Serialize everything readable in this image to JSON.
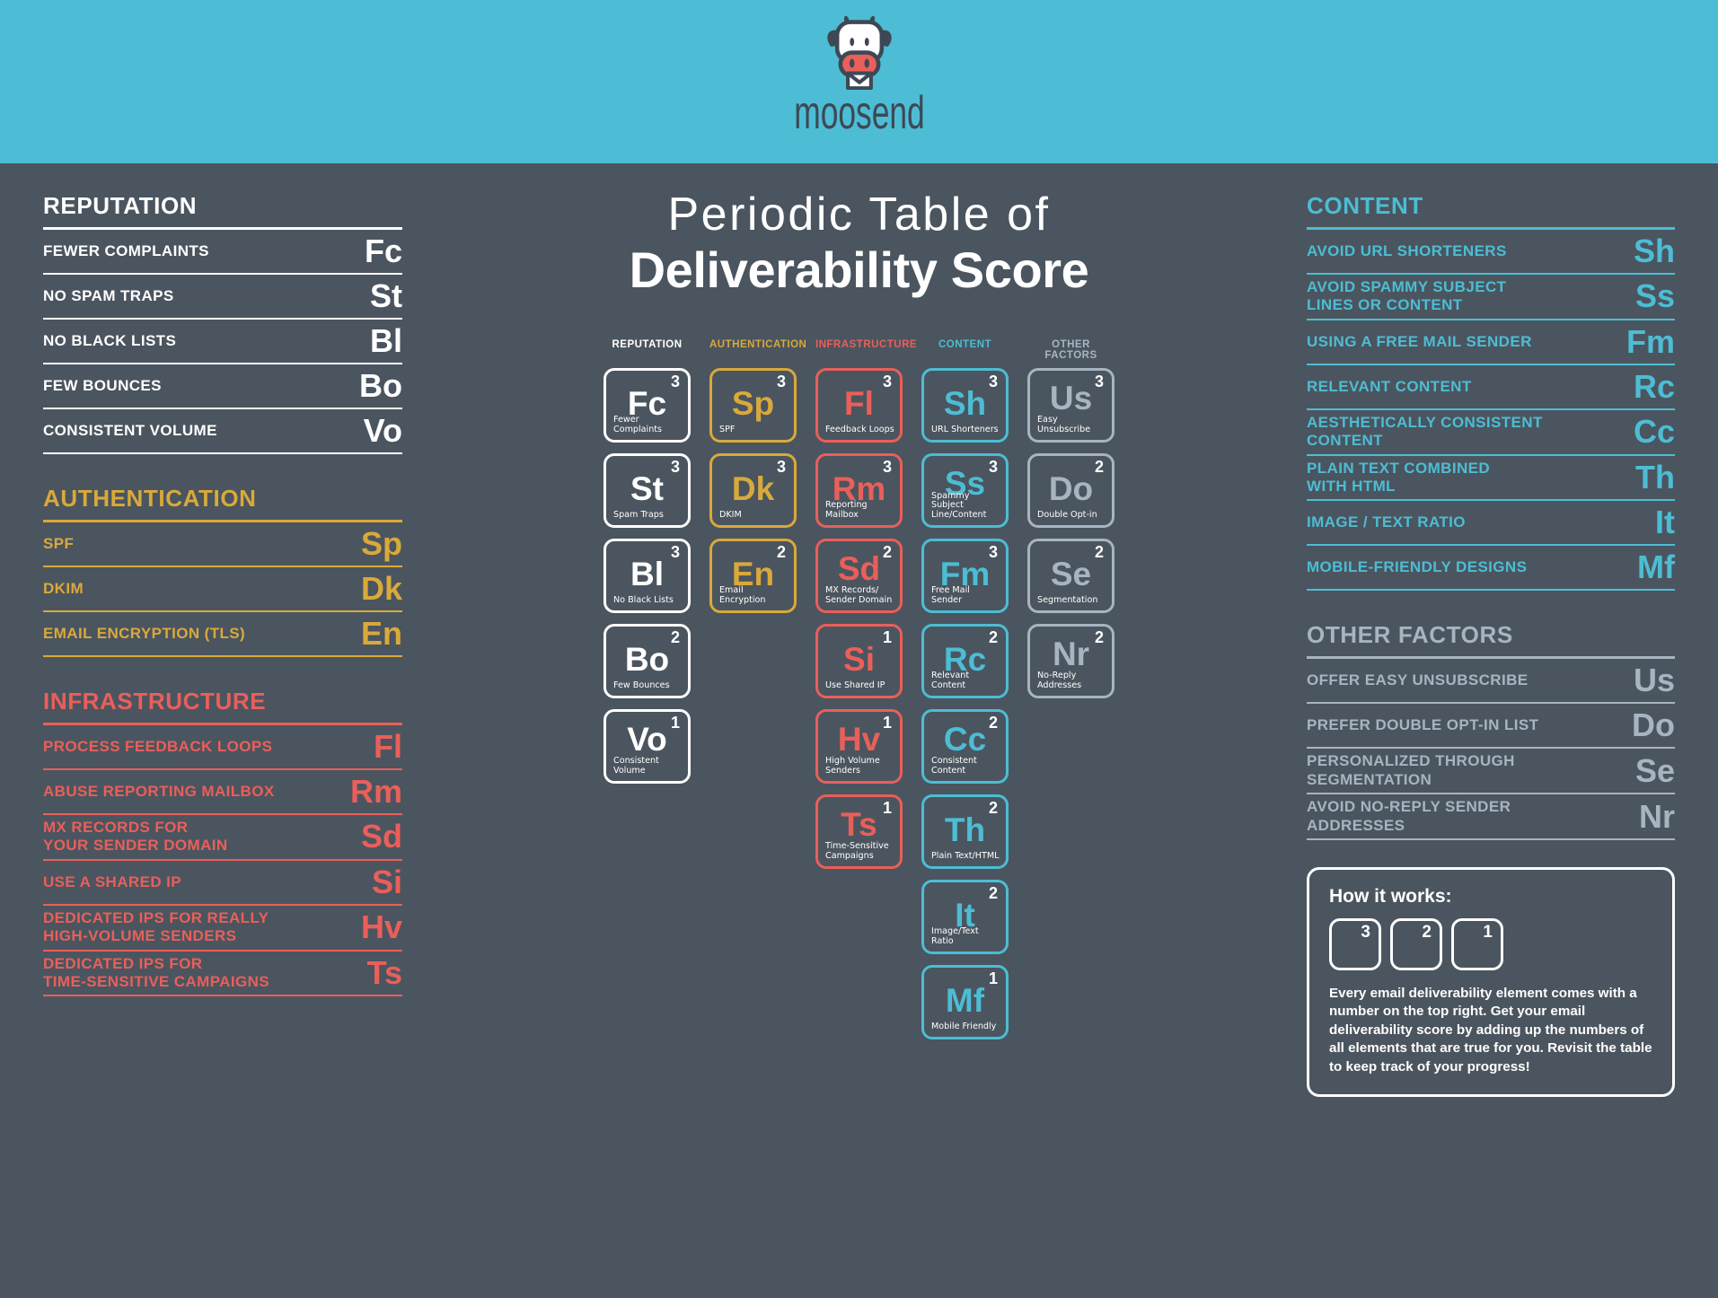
{
  "brand": {
    "name": "moosend",
    "logo_icon": "cow-envelope-logo",
    "header_bg": "#4cbdd4",
    "page_bg": "#4b555f"
  },
  "title": {
    "line1": "Periodic Table of",
    "line2": "Deliverability Score"
  },
  "colors": {
    "reputation": "#ffffff",
    "authentication": "#d9a93b",
    "infrastructure": "#ea5f5a",
    "content": "#4cbdd4",
    "other_factors": "#a7b4c2"
  },
  "left_sections": [
    {
      "title": "REPUTATION",
      "theme": "t-reputation",
      "rows": [
        {
          "label": "FEWER COMPLAINTS",
          "symbol": "Fc"
        },
        {
          "label": "NO SPAM TRAPS",
          "symbol": "St"
        },
        {
          "label": "NO BLACK LISTS",
          "symbol": "Bl"
        },
        {
          "label": "FEW BOUNCES",
          "symbol": "Bo"
        },
        {
          "label": "CONSISTENT VOLUME",
          "symbol": "Vo"
        }
      ]
    },
    {
      "title": "AUTHENTICATION",
      "theme": "t-auth",
      "rows": [
        {
          "label": "SPF",
          "symbol": "Sp"
        },
        {
          "label": "DKIM",
          "symbol": "Dk"
        },
        {
          "label": "EMAIL ENCRYPTION (TLS)",
          "symbol": "En"
        }
      ]
    },
    {
      "title": "INFRASTRUCTURE",
      "theme": "t-infra",
      "rows": [
        {
          "label": "PROCESS FEEDBACK LOOPS",
          "symbol": "Fl"
        },
        {
          "label": "ABUSE REPORTING MAILBOX",
          "symbol": "Rm"
        },
        {
          "label": "MX RECORDS FOR\nYOUR SENDER DOMAIN",
          "symbol": "Sd"
        },
        {
          "label": "USE A SHARED IP",
          "symbol": "Si"
        },
        {
          "label": "DEDICATED IPS FOR REALLY\nHIGH-VOLUME SENDERS",
          "symbol": "Hv"
        },
        {
          "label": "DEDICATED IPS FOR\nTIME-SENSITIVE CAMPAIGNS",
          "symbol": "Ts"
        }
      ]
    }
  ],
  "right_sections": [
    {
      "title": "CONTENT",
      "theme": "t-content",
      "rows": [
        {
          "label": "AVOID URL SHORTENERS",
          "symbol": "Sh"
        },
        {
          "label": "AVOID SPAMMY SUBJECT\nLINES OR CONTENT",
          "symbol": "Ss"
        },
        {
          "label": "USING A FREE MAIL SENDER",
          "symbol": "Fm"
        },
        {
          "label": "RELEVANT CONTENT",
          "symbol": "Rc"
        },
        {
          "label": "AESTHETICALLY CONSISTENT\nCONTENT",
          "symbol": "Cc"
        },
        {
          "label": "PLAIN TEXT COMBINED\nWITH HTML",
          "symbol": "Th"
        },
        {
          "label": "IMAGE / TEXT RATIO",
          "symbol": "It"
        },
        {
          "label": "MOBILE-FRIENDLY DESIGNS",
          "symbol": "Mf"
        }
      ]
    },
    {
      "title": "OTHER FACTORS",
      "theme": "t-other",
      "rows": [
        {
          "label": "OFFER EASY UNSUBSCRIBE",
          "symbol": "Us"
        },
        {
          "label": "PREFER DOUBLE OPT-IN LIST",
          "symbol": "Do"
        },
        {
          "label": "PERSONALIZED THROUGH\nSEGMENTATION",
          "symbol": "Se"
        },
        {
          "label": "AVOID NO-REPLY SENDER\nADDRESSES",
          "symbol": "Nr"
        }
      ]
    }
  ],
  "table": {
    "column_headers": [
      "REPUTATION",
      "AUTHENTICATION",
      "INFRASTRUCTURE",
      "CONTENT",
      "OTHER FACTORS"
    ],
    "column_themes": [
      "b-reputation",
      "b-auth",
      "b-infra",
      "b-content",
      "b-other"
    ],
    "columns": [
      [
        {
          "symbol": "Fc",
          "score": "3",
          "name": "Fewer Complaints"
        },
        {
          "symbol": "St",
          "score": "3",
          "name": "Spam Traps"
        },
        {
          "symbol": "Bl",
          "score": "3",
          "name": "No Black Lists"
        },
        {
          "symbol": "Bo",
          "score": "2",
          "name": "Few Bounces"
        },
        {
          "symbol": "Vo",
          "score": "1",
          "name": "Consistent\nVolume"
        }
      ],
      [
        {
          "symbol": "Sp",
          "score": "3",
          "name": "SPF"
        },
        {
          "symbol": "Dk",
          "score": "3",
          "name": "DKIM"
        },
        {
          "symbol": "En",
          "score": "2",
          "name": "Email Encryption"
        }
      ],
      [
        {
          "symbol": "Fl",
          "score": "3",
          "name": "Feedback Loops"
        },
        {
          "symbol": "Rm",
          "score": "3",
          "name": "Reporting Mailbox"
        },
        {
          "symbol": "Sd",
          "score": "2",
          "name": "MX Records/\nSender Domain"
        },
        {
          "symbol": "Si",
          "score": "1",
          "name": "Use Shared IP"
        },
        {
          "symbol": "Hv",
          "score": "1",
          "name": "High Volume\nSenders"
        },
        {
          "symbol": "Ts",
          "score": "1",
          "name": "Time-Sensitive\nCampaigns"
        }
      ],
      [
        {
          "symbol": "Sh",
          "score": "3",
          "name": "URL Shorteners"
        },
        {
          "symbol": "Ss",
          "score": "3",
          "name": "Spammy Subject\nLine/Content"
        },
        {
          "symbol": "Fm",
          "score": "3",
          "name": "Free Mail Sender"
        },
        {
          "symbol": "Rc",
          "score": "2",
          "name": "Relevant Content"
        },
        {
          "symbol": "Cc",
          "score": "2",
          "name": "Consistent\nContent"
        },
        {
          "symbol": "Th",
          "score": "2",
          "name": "Plain Text/HTML"
        },
        {
          "symbol": "It",
          "score": "2",
          "name": "Image/Text Ratio"
        },
        {
          "symbol": "Mf",
          "score": "1",
          "name": "Mobile Friendly"
        }
      ],
      [
        {
          "symbol": "Us",
          "score": "3",
          "name": "Easy\nUnsubscribe"
        },
        {
          "symbol": "Do",
          "score": "2",
          "name": "Double Opt-in"
        },
        {
          "symbol": "Se",
          "score": "2",
          "name": "Segmentation"
        },
        {
          "symbol": "Nr",
          "score": "2",
          "name": "No-Reply\nAddresses"
        }
      ]
    ]
  },
  "how_it_works": {
    "title": "How it works:",
    "chips": [
      "3",
      "2",
      "1"
    ],
    "text": "Every email deliverability element comes with a number on the top right. Get your email deliverability score by adding up the numbers of all elements that are true for you. Revisit the table to keep track of your progress!"
  }
}
